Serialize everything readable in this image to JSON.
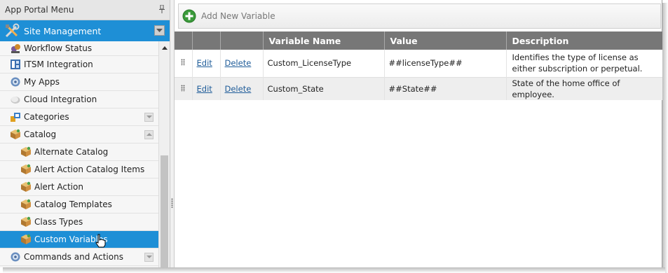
{
  "sidebar": {
    "title": "App Portal Menu",
    "section": {
      "label": "Site Management",
      "icon": "tools-icon"
    },
    "items": [
      {
        "label": "Workflow Status",
        "icon": "workflow-icon",
        "child": false,
        "expander": null
      },
      {
        "label": "ITSM Integration",
        "icon": "itsm-icon",
        "child": false,
        "expander": null
      },
      {
        "label": "My Apps",
        "icon": "gear-icon",
        "child": false,
        "expander": null
      },
      {
        "label": "Cloud Integration",
        "icon": "cloud-icon",
        "child": false,
        "expander": null
      },
      {
        "label": "Categories",
        "icon": "categories-icon",
        "child": false,
        "expander": "down"
      },
      {
        "label": "Catalog",
        "icon": "box-icon",
        "child": false,
        "expander": "up"
      },
      {
        "label": "Alternate Catalog",
        "icon": "box-icon",
        "child": true,
        "expander": null
      },
      {
        "label": "Alert Action Catalog Items",
        "icon": "box-icon",
        "child": true,
        "expander": null
      },
      {
        "label": "Alert Action",
        "icon": "box-icon",
        "child": true,
        "expander": null
      },
      {
        "label": "Catalog Templates",
        "icon": "box-icon",
        "child": true,
        "expander": null
      },
      {
        "label": "Class Types",
        "icon": "box-icon",
        "child": true,
        "expander": null
      },
      {
        "label": "Custom Variables",
        "icon": "box-icon",
        "child": true,
        "expander": null,
        "selected": true
      },
      {
        "label": "Commands and Actions",
        "icon": "gear-icon",
        "child": false,
        "expander": "down"
      }
    ]
  },
  "toolbar": {
    "add_label": "Add New Variable"
  },
  "table": {
    "columns": [
      "Variable Name",
      "Value",
      "Description"
    ],
    "edit_label": "Edit",
    "delete_label": "Delete",
    "rows": [
      {
        "name": "Custom_LicenseType",
        "value": "##licenseType##",
        "description": "Identifies the type of license as either subscription or perpetual."
      },
      {
        "name": "Custom_State",
        "value": "##State##",
        "description": "State of the home office of employee."
      }
    ]
  },
  "colors": {
    "accent": "#1e8fd6",
    "header": "#777777",
    "link": "#1f5c99",
    "add_icon": "#3a9a3a"
  }
}
